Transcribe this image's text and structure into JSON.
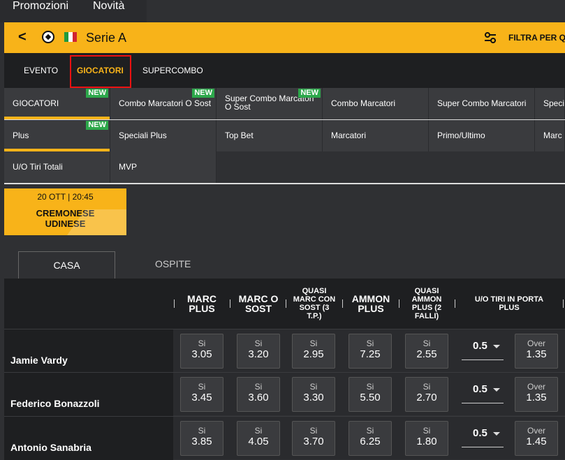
{
  "topnav": {
    "promozioni": "Promozioni",
    "novita": "Novità"
  },
  "header": {
    "back": "<",
    "title": "Serie A",
    "filter": "FILTRA PER QU",
    "flag_colors": [
      "#1f9a3b",
      "#ffffff",
      "#d12430"
    ]
  },
  "tabs": [
    "EVENTO",
    "GIOCATORI",
    "SUPERCOMBO"
  ],
  "active_tab": "GIOCATORI",
  "markets": [
    [
      "GIOCATORI",
      "Combo Marcatori O Sost",
      "Super Combo Marcatori O Sost",
      "Combo Marcatori",
      "Super Combo Marcatori",
      "Speci"
    ],
    [
      "Plus",
      "Speciali Plus",
      "Top Bet",
      "Marcatori",
      "Primo/Ultimo",
      "Marc"
    ],
    [
      "U/O Tiri Totali",
      "MVP"
    ]
  ],
  "new_label": "NEW",
  "event": {
    "datetime": "20 OTT | 20:45",
    "home": "CREMONESE",
    "away": "UDINESE"
  },
  "team_tabs": {
    "casa": "CASA",
    "ospite": "OSPITE"
  },
  "columns": [
    "MARC PLUS",
    "MARC O SOST",
    "QUASI MARC CON SOST (3 T.P.)",
    "AMMON PLUS",
    "QUASI AMMON PLUS (2 FALLI)",
    "U/O TIRI IN PORTA PLUS"
  ],
  "players": [
    {
      "name": "Jamie Vardy",
      "odds": [
        "3.05",
        "3.20",
        "2.95",
        "7.25",
        "2.55"
      ],
      "line": "0.5",
      "over": "1.35"
    },
    {
      "name": "Federico Bonazzoli",
      "odds": [
        "3.45",
        "3.60",
        "3.30",
        "5.50",
        "2.70"
      ],
      "line": "0.5",
      "over": "1.35"
    },
    {
      "name": "Antonio Sanabria",
      "odds": [
        "3.85",
        "4.05",
        "3.70",
        "6.25",
        "1.80"
      ],
      "line": "0.5",
      "over": "1.45"
    }
  ],
  "odd_key": "Si",
  "over_key": "Over"
}
